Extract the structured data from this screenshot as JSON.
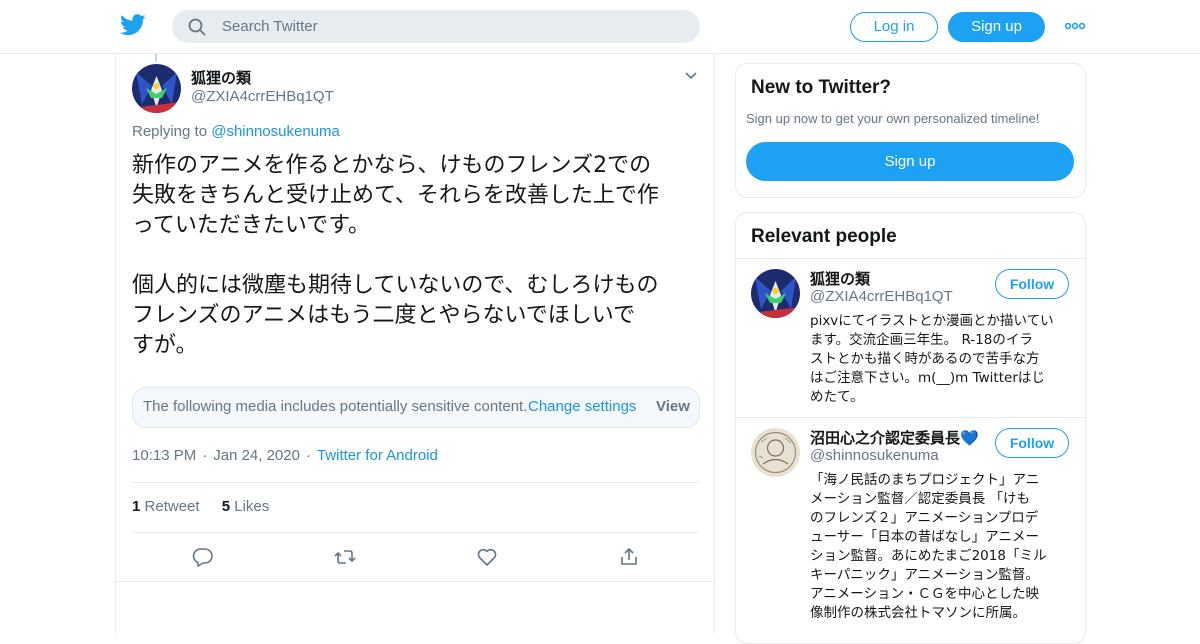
{
  "header": {
    "search_placeholder": "Search Twitter",
    "login_label": "Log in",
    "signup_label": "Sign up",
    "brand_color": "#1da1f2"
  },
  "tweet": {
    "author_name": "狐狸の類",
    "author_handle": "@ZXIA4crrEHBq1QT",
    "replying_prefix": "Replying to",
    "replying_to": "@shinnosukenuma",
    "text_lines_p1": [
      "新作のアニメを作るとかなら、けものフレンズ2での",
      "失敗をきちんと受け止めて、それらを改善した上で作",
      "っていただきたいです。"
    ],
    "text_lines_p2": [
      "個人的には微塵も期待していないので、むしろけもの",
      "フレンズのアニメはもう二度とやらないでほしいで",
      "すが。"
    ],
    "sensitive_notice": "The following media includes potentially sensitive content.",
    "sensitive_link": "Change settings",
    "sensitive_view": "View",
    "time": "10:13 PM",
    "date": "Jan 24, 2020",
    "source": "Twitter for Android",
    "retweets_count": "1",
    "retweets_label": "Retweet",
    "likes_count": "5",
    "likes_label": "Likes",
    "actions": [
      "reply-icon",
      "retweet-icon",
      "like-icon",
      "share-icon"
    ]
  },
  "sidebar": {
    "signup_card": {
      "title": "New to Twitter?",
      "subtitle": "Sign up now to get your own personalized timeline!",
      "button": "Sign up"
    },
    "relevant": {
      "title": "Relevant people",
      "people": [
        {
          "name": "狐狸の類",
          "handle": "@ZXIA4crrEHBq1QT",
          "follow": "Follow",
          "bio_lines": [
            "pixvにてイラストとか漫画とか描いてい",
            "ます。交流企画三年生。 R-18のイラ",
            "ストとかも描く時があるので苦手な方",
            "はご注意下さい。m(__)m Twitterはじ",
            "めたて。"
          ]
        },
        {
          "name": "沼田心之介認定委員長💙",
          "handle": "@shinnosukenuma",
          "follow": "Follow",
          "bio_lines": [
            "「海ノ民話のまちプロジェクト」アニ",
            "メーション監督／認定委員長 「けも",
            "のフレンズ２」アニメーションプロデ",
            "ューサー「日本の昔ばなし」アニメー",
            "ション監督。あにめたまご2018「ミル",
            "キーパニック」アニメーション監督。",
            "アニメーション・ＣＧを中心とした映",
            "像制作の株式会社トマソンに所属。"
          ]
        }
      ]
    }
  }
}
